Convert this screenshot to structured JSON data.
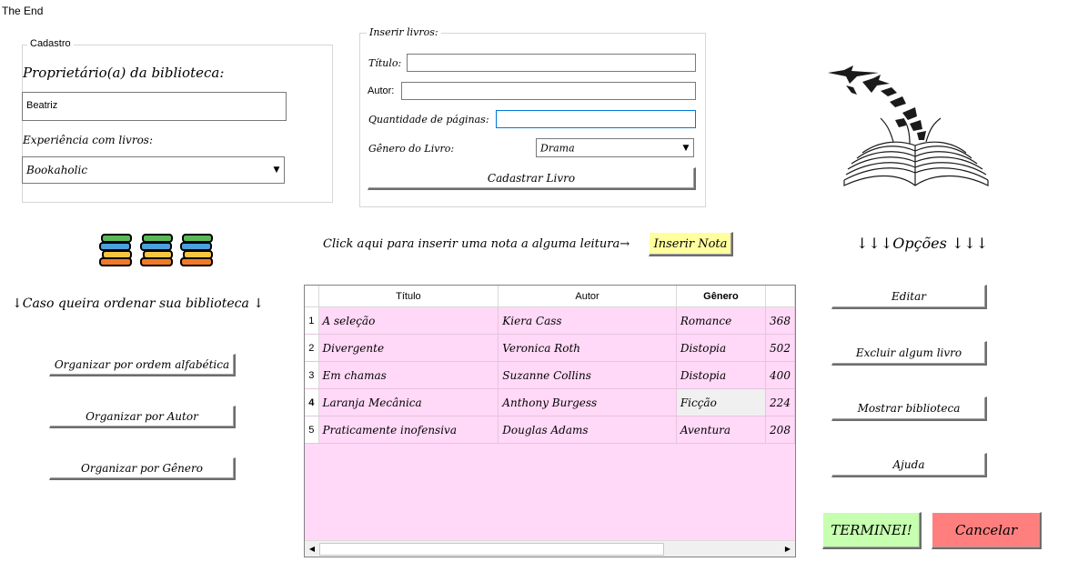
{
  "window": {
    "title": "The End"
  },
  "cadastro": {
    "legend": "Cadastro",
    "owner_label": "Proprietário(a)  da biblioteca:",
    "owner_value": "Beatriz",
    "experience_label": "Experiência com livros:",
    "experience_value": "Bookaholic"
  },
  "insert": {
    "legend": "Inserir livros:",
    "title_label": "Título:",
    "title_value": "",
    "author_label": "Autor:",
    "author_value": "",
    "pages_label": "Quantidade de páginas:",
    "pages_value": "",
    "genre_label": "Gênero do Livro:",
    "genre_value": "Drama",
    "register_button": "Cadastrar Livro"
  },
  "note": {
    "prompt": "Click aqui para inserir uma nota a alguma leitura→",
    "button": "Inserir Nota"
  },
  "sort": {
    "heading": "↓Caso queira ordenar sua biblioteca ↓",
    "alpha_button": "Organizar por ordem alfabética",
    "author_button": "Organizar por Autor",
    "genre_button": "Organizar por Gênero"
  },
  "options": {
    "heading": "↓↓↓Opções ↓↓↓",
    "edit_button": "Editar",
    "delete_button": "Excluir algum livro",
    "show_button": "Mostrar biblioteca",
    "help_button": "Ajuda"
  },
  "actions": {
    "finish_button": "TERMINEI!",
    "cancel_button": "Cancelar",
    "finish_color": "#c6ffb0",
    "cancel_color": "#ff7f7f"
  },
  "table": {
    "headers": [
      "Título",
      "Autor",
      "Gênero",
      ""
    ],
    "rows": [
      {
        "num": "1",
        "title": "A seleção",
        "author": "Kiera Cass",
        "genre": "Romance",
        "pages": "368"
      },
      {
        "num": "2",
        "title": "Divergente",
        "author": "Veronica Roth",
        "genre": "Distopia",
        "pages": "502"
      },
      {
        "num": "3",
        "title": "Em chamas",
        "author": "Suzanne Collins",
        "genre": "Distopia",
        "pages": "400"
      },
      {
        "num": "4",
        "title": "Laranja Mecânica",
        "author": "Anthony Burgess",
        "genre": "Ficção",
        "pages": "224"
      },
      {
        "num": "5",
        "title": "Praticamente inofensiva",
        "author": "Douglas Adams",
        "genre": "Aventura",
        "pages": "208"
      }
    ],
    "background": "#ffd9f7"
  },
  "icons": [
    "books-stack-icon",
    "books-stack-icon",
    "books-stack-icon",
    "open-book-birds-icon",
    "chevron-down-icon",
    "arrow-left-icon",
    "arrow-right-icon"
  ]
}
